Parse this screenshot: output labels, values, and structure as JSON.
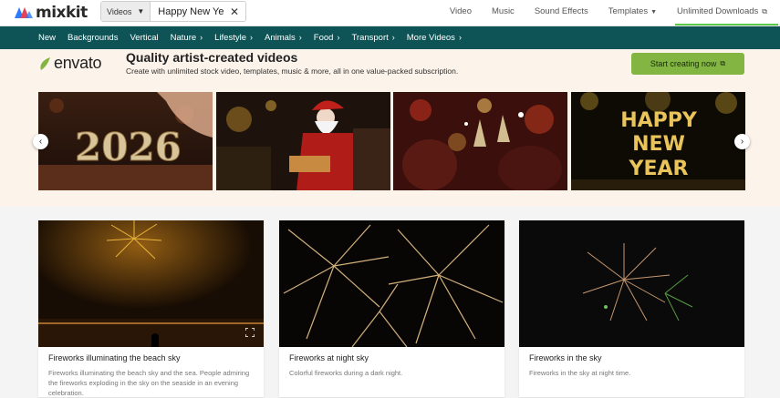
{
  "brand": {
    "logo_text": "mixkit",
    "accent": "#0e5457",
    "logo_colors": [
      "#2b7cff",
      "#e0435a"
    ]
  },
  "search": {
    "type_label": "Videos",
    "query": "Happy New Year",
    "clear_icon": "close-icon"
  },
  "top_nav": {
    "video": "Video",
    "music": "Music",
    "sound_effects": "Sound Effects",
    "templates": "Templates",
    "unlimited": "Unlimited Downloads"
  },
  "categories": [
    "New",
    "Backgrounds",
    "Vertical",
    "Nature",
    "Lifestyle",
    "Animals",
    "Food",
    "Transport",
    "More Videos"
  ],
  "promo": {
    "brand": "envato",
    "title": "Quality artist-created videos",
    "subtitle": "Create with unlimited stock video, templates, music & more, all in one value-packed subscription.",
    "cta": "Start creating now",
    "cta_color": "#82b541",
    "thumbnails": [
      {
        "overlay_text": "2026"
      },
      {
        "overlay_text": ""
      },
      {
        "overlay_text": ""
      },
      {
        "overlay_text": "HAPPY NEW YEAR"
      }
    ]
  },
  "videos": [
    {
      "title": "Fireworks illuminating the beach sky",
      "description": "Fireworks illuminating the beach sky and the sea. People admiring the fireworks exploding in the sky on the seaside in an evening celebration."
    },
    {
      "title": "Fireworks at night sky",
      "description": "Colorful fireworks during a dark night."
    },
    {
      "title": "Fireworks in the sky",
      "description": "Fireworks in the sky at night time."
    }
  ]
}
